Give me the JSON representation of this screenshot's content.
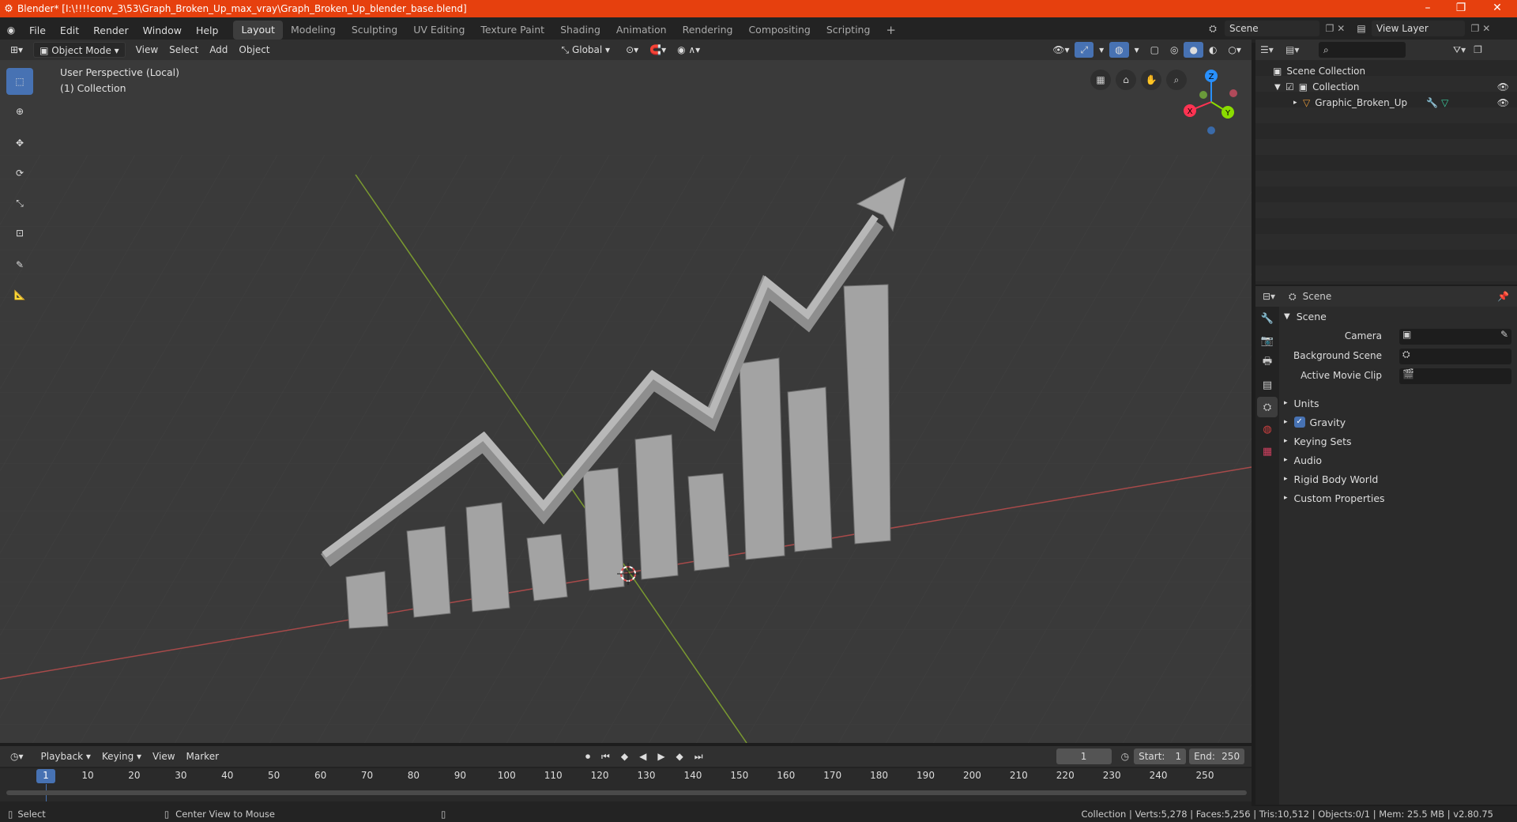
{
  "window": {
    "title": "Blender* [I:\\!!!!conv_3\\53\\Graph_Broken_Up_max_vray\\Graph_Broken_Up_blender_base.blend]",
    "minimize": "–",
    "maximize": "❐",
    "close": "✕"
  },
  "menu": {
    "items": [
      "File",
      "Edit",
      "Render",
      "Window",
      "Help"
    ]
  },
  "workspaces": [
    "Layout",
    "Modeling",
    "Sculpting",
    "UV Editing",
    "Texture Paint",
    "Shading",
    "Animation",
    "Rendering",
    "Compositing",
    "Scripting"
  ],
  "workspace_add": "+",
  "scene_selector": {
    "label": "Scene",
    "view_layer": "View Layer"
  },
  "viewport_header": {
    "mode": "Object Mode",
    "menus": [
      "View",
      "Select",
      "Add",
      "Object"
    ],
    "transform_orientation": "Global"
  },
  "viewport": {
    "perspective_label": "User Perspective (Local)",
    "collection_label": "(1) Collection",
    "gizmo_x": "X",
    "gizmo_y": "Y",
    "gizmo_z": "Z"
  },
  "outliner": {
    "root": "Scene Collection",
    "collection": "Collection",
    "object": "Graphic_Broken_Up",
    "search_placeholder": ""
  },
  "properties": {
    "header": "Scene",
    "panel": "Scene",
    "camera_label": "Camera",
    "background_scene_label": "Background Scene",
    "active_movie_clip_label": "Active Movie Clip",
    "subpanels": [
      "Units",
      "Gravity",
      "Keying Sets",
      "Audio",
      "Rigid Body World",
      "Custom Properties"
    ],
    "gravity_checked": true
  },
  "timeline": {
    "menus": [
      "Playback",
      "Keying",
      "View",
      "Marker"
    ],
    "current_frame": "1",
    "start_label": "Start:",
    "start": "1",
    "end_label": "End:",
    "end": "250",
    "ruler": [
      "1",
      "10",
      "20",
      "30",
      "40",
      "50",
      "60",
      "70",
      "80",
      "90",
      "100",
      "110",
      "120",
      "130",
      "140",
      "150",
      "160",
      "170",
      "180",
      "190",
      "200",
      "210",
      "220",
      "230",
      "240",
      "250"
    ]
  },
  "statusbar": {
    "left_action": "Select",
    "middle_action": "Center View to Mouse",
    "stats": "Collection | Verts:5,278 | Faces:5,256 | Tris:10,512 | Objects:0/1 | Mem: 25.5 MB | v2.80.75"
  },
  "colors": {
    "titlebar": "#e6400e",
    "accent": "#4772b3",
    "axis_x": "#ff3352",
    "axis_y": "#8bdc00",
    "axis_z": "#2890ff"
  }
}
